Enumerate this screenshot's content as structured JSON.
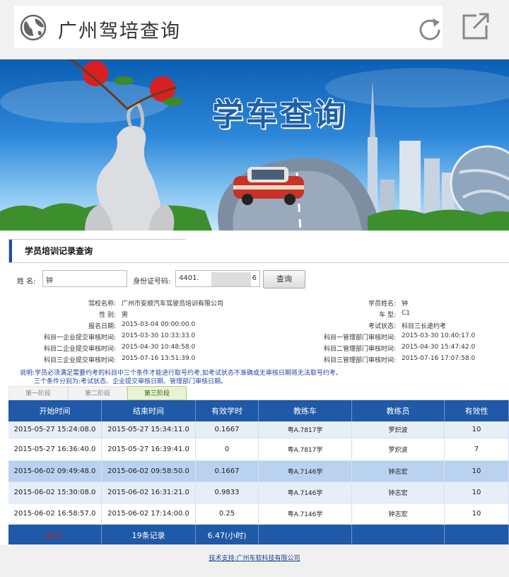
{
  "browser": {
    "title": "广州驾培查询",
    "icons": {
      "site": "globe-icon",
      "reload": "reload-icon",
      "share": "share-icon"
    }
  },
  "banner": {
    "title": "学车查询"
  },
  "section": {
    "title": "学员培训记录查询"
  },
  "search": {
    "name_label": "姓 名:",
    "name_value": "钟",
    "id_label": "身份证号码:",
    "id_value": "4401.",
    "id_value_tail": "6",
    "query_button": "查询"
  },
  "info": {
    "left": [
      {
        "key": "驾校名称:",
        "value": "广州市安顺汽车驾驶员培训有限公司"
      },
      {
        "key": "性 别:",
        "value": "男"
      },
      {
        "key": "报名日期:",
        "value": "2015-03-04 00:00:00.0"
      },
      {
        "key": "科目一企业提交审核时间:",
        "value": "2015-03-30 10:33:33.0"
      },
      {
        "key": "科目二企业提交审核时间:",
        "value": "2015-04-30 10:48:58.0"
      },
      {
        "key": "科目三企业提交审核时间:",
        "value": "2015-07-16 13:51:39.0"
      }
    ],
    "right": [
      {
        "key": "学员姓名:",
        "value": "钟"
      },
      {
        "key": "车 型:",
        "value": "C1"
      },
      {
        "key": "考试状态:",
        "value": "科目三长途约考"
      },
      {
        "key": "科目一管理部门审核时间:",
        "value": "2015-03-30 10:40:17.0"
      },
      {
        "key": "科目二管理部门审核时间:",
        "value": "2015-04-30 15:47:42.0"
      },
      {
        "key": "科目三管理部门审核时间:",
        "value": "2015-07-16 17:07:58.0"
      }
    ]
  },
  "notes": {
    "line1": "说明:学员必须满足需要约考的科目中三个条件才能进行取号约考,如考试状态不准确或无审核日期将无法取号约考。",
    "line2": "三个条件分别为:考试状态、企业提交审核日期、管理部门审核日期。"
  },
  "tabs": [
    "第一阶段",
    "第二阶段",
    "第三阶段"
  ],
  "active_tab": 2,
  "table": {
    "headers": [
      "开始时间",
      "结束时间",
      "有效学时",
      "教练车",
      "教练员",
      "有效性"
    ],
    "rows": [
      [
        "2015-05-27 15:24:08.0",
        "2015-05-27 15:34:11.0",
        "0.1667",
        "粤A.7817学",
        "罗炽波",
        "10"
      ],
      [
        "2015-05-27 16:36:40.0",
        "2015-05-27 16:39:41.0",
        "0",
        "粤A.7817学",
        "罗炽波",
        "7"
      ],
      [
        "2015-06-02 09:49:48.0",
        "2015-06-02 09:58:50.0",
        "0.1667",
        "粤A.7146学",
        "钟志宏",
        "10"
      ],
      [
        "2015-06-02 15:30:08.0",
        "2015-06-02 16:31:21.0",
        "0.9833",
        "粤A.7146学",
        "钟志宏",
        "10"
      ],
      [
        "2015-06-02 16:58:57.0",
        "2015-06-02 17:14:00.0",
        "0.25",
        "粤A.7146学",
        "钟志宏",
        "10"
      ]
    ],
    "footer": [
      "合计:",
      "19条记录",
      "6.47(小时)",
      "",
      "",
      ""
    ]
  },
  "footer": {
    "link": "技术支持:广州车软科技有限公司"
  },
  "colors": {
    "header_blue": "#1f59a7",
    "row_light": "#e6eef8",
    "row_white": "#ffffff",
    "row_highlight": "#b9d2f0",
    "total_red": "#cc2222"
  }
}
